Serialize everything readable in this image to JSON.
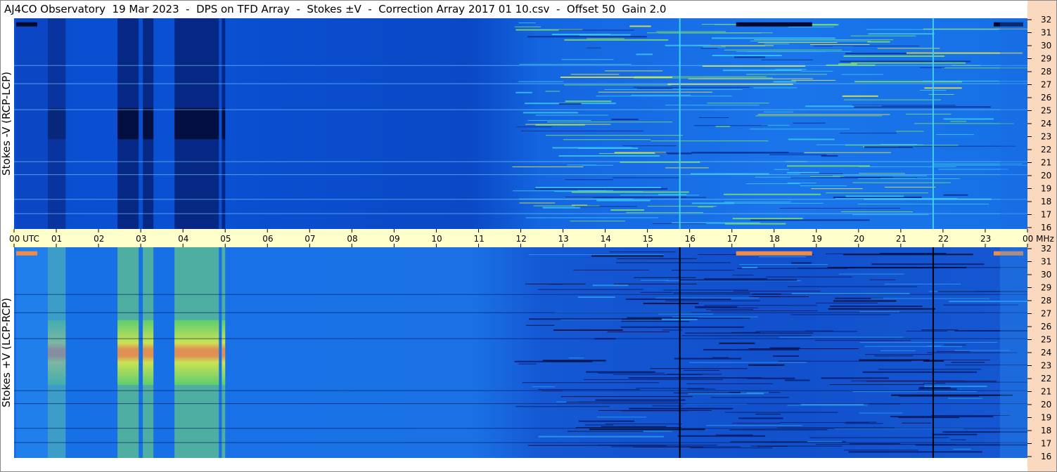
{
  "title": "AJ4CO Observatory  19 Mar 2023  -  DPS on TFD Array  -  Stokes ±V  -  Correction Array 2017 01 10.csv  -  Offset 50  Gain 2.0",
  "colors": {
    "time_band": "#ffffcc",
    "freq_band": "#fbd9bf",
    "background": "#ffffff"
  },
  "chart_data": [
    {
      "type": "heatmap",
      "panel": "top",
      "ylabel": "Stokes -V (RCP-LCP)",
      "freq_ticks": [
        "32",
        "31",
        "30",
        "29",
        "28",
        "27",
        "26",
        "25",
        "24",
        "23",
        "22",
        "21",
        "20",
        "19",
        "18",
        "17",
        "16"
      ],
      "ylim": [
        16,
        32
      ]
    },
    {
      "type": "heatmap",
      "panel": "bottom",
      "ylabel": "Stokes +V (LCP-RCP)",
      "freq_ticks": [
        "32",
        "31",
        "30",
        "29",
        "28",
        "27",
        "26",
        "25",
        "24",
        "23",
        "22",
        "21",
        "20",
        "19",
        "18",
        "17",
        "16"
      ],
      "ylim": [
        16,
        32
      ]
    }
  ],
  "time_axis": {
    "labels": [
      "00 UTC",
      "01",
      "02",
      "03",
      "04",
      "05",
      "06",
      "07",
      "08",
      "09",
      "10",
      "11",
      "12",
      "13",
      "14",
      "15",
      "16",
      "17",
      "18",
      "19",
      "20",
      "21",
      "22",
      "23",
      "00 MHz"
    ],
    "xlim_hours": [
      0,
      24
    ]
  }
}
